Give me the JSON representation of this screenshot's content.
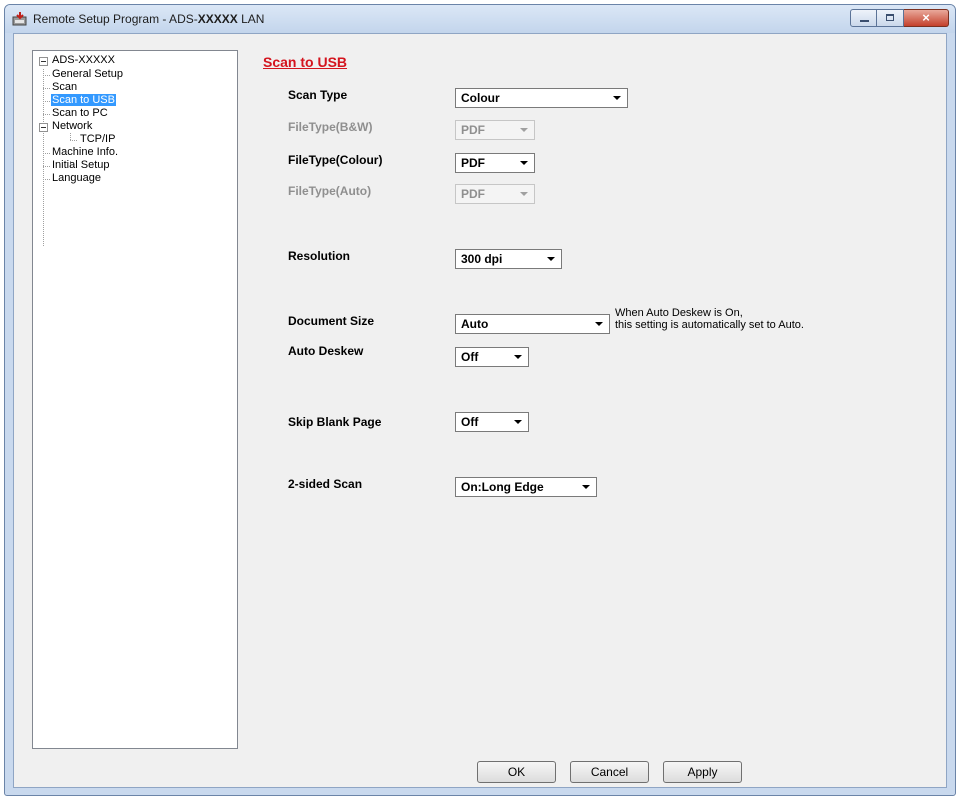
{
  "window": {
    "title_prefix": "Remote Setup Program - ADS-",
    "title_model": "XXXXX",
    "title_suffix": " LAN",
    "icon": "app-icon",
    "caption": {
      "minimize": "minimize-icon",
      "maximize": "maximize-icon",
      "close": "×"
    }
  },
  "tree": {
    "root": "ADS-XXXXX",
    "items": [
      {
        "label": "General Setup"
      },
      {
        "label": "Scan"
      },
      {
        "label": "Scan to USB",
        "selected": true
      },
      {
        "label": "Scan to PC"
      },
      {
        "label": "Network"
      },
      {
        "label": "TCP/IP"
      },
      {
        "label": "Machine Info."
      },
      {
        "label": "Initial Setup"
      },
      {
        "label": "Language"
      }
    ]
  },
  "panel": {
    "title": "Scan to USB",
    "fields": [
      {
        "label": "Scan Type",
        "value": "Colour",
        "enabled": true
      },
      {
        "label": "FileType(B&W)",
        "value": "PDF",
        "enabled": false
      },
      {
        "label": "FileType(Colour)",
        "value": "PDF",
        "enabled": true
      },
      {
        "label": "FileType(Auto)",
        "value": "PDF",
        "enabled": false
      },
      {
        "label": "Resolution",
        "value": "300 dpi",
        "enabled": true
      },
      {
        "label": "Document Size",
        "value": "Auto",
        "enabled": true
      },
      {
        "label": "Auto Deskew",
        "value": "Off",
        "enabled": true
      },
      {
        "label": "Skip Blank Page",
        "value": "Off",
        "enabled": true
      },
      {
        "label": "2-sided Scan",
        "value": "On:Long Edge",
        "enabled": true
      }
    ],
    "note_line1": "When Auto Deskew is On,",
    "note_line2": "this setting is automatically set to Auto."
  },
  "buttons": {
    "ok": "OK",
    "cancel": "Cancel",
    "apply": "Apply"
  },
  "colors": {
    "selection": "#3399ff",
    "section_title": "#d4141e",
    "window_frame": "#c9d9ee"
  }
}
